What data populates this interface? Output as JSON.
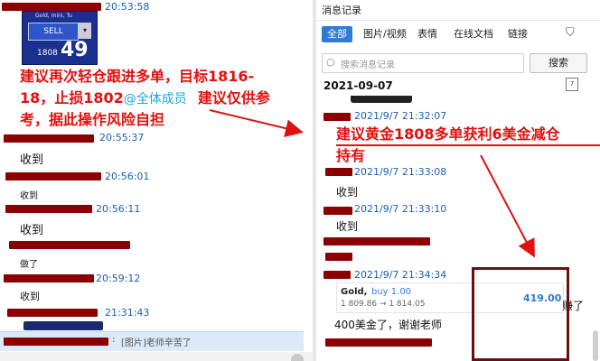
{
  "left": {
    "top_timestamp": "20:53:58",
    "ticket": {
      "header": "Gold, mini, Tu",
      "sell_label": "SELL",
      "price_main": "1808",
      "price_big": "49"
    },
    "annotation": {
      "line1": "建议再次轻仓跟进多单，目标1816-",
      "line2a": "18，止损1802",
      "mention": "@全体成员",
      "line2b": "建议仅供参",
      "line3": "考，据此操作风险自担"
    },
    "messages": [
      {
        "time": "20:55:37",
        "text": "收到"
      },
      {
        "time": "20:56:01",
        "text": "收到"
      },
      {
        "time": "20:56:11",
        "text": "收到"
      },
      {
        "time": "",
        "text": "做了"
      },
      {
        "time": "20:59:12",
        "text": "收到"
      },
      {
        "time": "21:31:43",
        "text": ""
      }
    ],
    "reply_bar": {
      "text": "[图片]老师辛苦了",
      "prefix": ":"
    }
  },
  "right": {
    "header_title": "消息记录",
    "tabs": [
      "全部",
      "图片/视频",
      "表情",
      "在线文档",
      "链接"
    ],
    "search": {
      "placeholder": "搜索消息记录",
      "button": "搜索"
    },
    "date": "2021-09-07",
    "entries": [
      {
        "time": "2021/9/7 21:32:07"
      },
      {
        "time": "2021/9/7 21:33:08",
        "text": "收到"
      },
      {
        "time": "2021/9/7 21:33:10",
        "text": "收到"
      },
      {
        "time": "2021/9/7 21:34:34"
      }
    ],
    "annotation": {
      "line1": "建议黄金1808多单获利6美金减仓",
      "line2": "持有"
    },
    "gold_card": {
      "symbol": "Gold,",
      "action": "buy 1.00",
      "prices": "1 809.86 → 1 814.05",
      "profit": "419.00"
    },
    "earned_text": "赚了",
    "last_message": "400美金了，谢谢老师"
  }
}
